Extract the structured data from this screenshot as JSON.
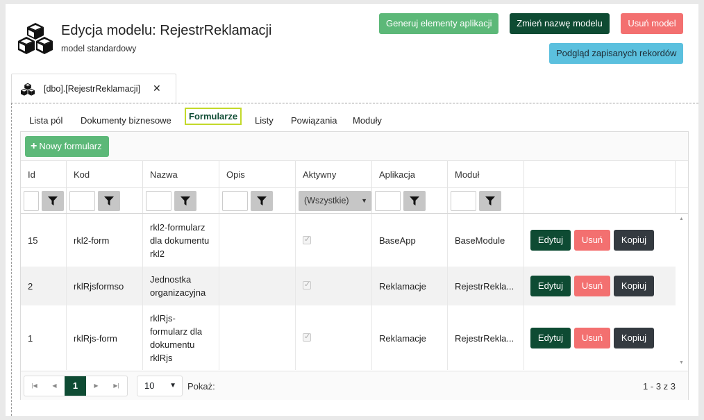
{
  "header": {
    "title": "Edycja modelu: RejestrReklamacji",
    "subtitle": "model standardowy",
    "btn_generate": "Generuj elementy aplikacji",
    "btn_rename": "Zmień nazwę modelu",
    "btn_delete": "Usuń model",
    "btn_preview": "Podgląd zapisanych rekordów"
  },
  "doc_tab": {
    "label": "[dbo].[RejestrReklamacji]",
    "close": "✕"
  },
  "subtabs": [
    "Lista pól",
    "Dokumenty biznesowe",
    "Formularze",
    "Listy",
    "Powiązania",
    "Moduły"
  ],
  "active_subtab": "Formularze",
  "toolbar": {
    "new_form": "Nowy formularz"
  },
  "columns": [
    "Id",
    "Kod",
    "Nazwa",
    "Opis",
    "Aktywny",
    "Aplikacja",
    "Moduł"
  ],
  "filters": {
    "active_select": "(Wszystkie)"
  },
  "rows": [
    {
      "id": "15",
      "kod": "rkl2-form",
      "nazwa": [
        "rkl2-formularz",
        "dla dokumentu",
        "rkl2"
      ],
      "opis": "",
      "aktywny": true,
      "aplikacja": "BaseApp",
      "modul": "BaseModule"
    },
    {
      "id": "2",
      "kod": "rklRjsformso",
      "nazwa": [
        "Jednostka",
        "organizacyjna"
      ],
      "opis": "",
      "aktywny": true,
      "aplikacja": "Reklamacje",
      "modul": "RejestrRekla..."
    },
    {
      "id": "1",
      "kod": "rklRjs-form",
      "nazwa": [
        "rklRjs-",
        "formularz dla",
        "dokumentu",
        "rklRjs"
      ],
      "opis": "",
      "aktywny": true,
      "aplikacja": "Reklamacje",
      "modul": "RejestrRekla..."
    }
  ],
  "row_actions": {
    "edit": "Edytuj",
    "delete": "Usuń",
    "copy": "Kopiuj"
  },
  "pager": {
    "current_page": "1",
    "page_size": "10",
    "show_label": "Pokaż:",
    "info": "1 - 3 z 3"
  },
  "colors": {
    "accent_dark": "#0e4b33",
    "green": "#5cb878",
    "red": "#f37070",
    "blue": "#5bc0de",
    "tab_highlight": "#c3d92a"
  }
}
